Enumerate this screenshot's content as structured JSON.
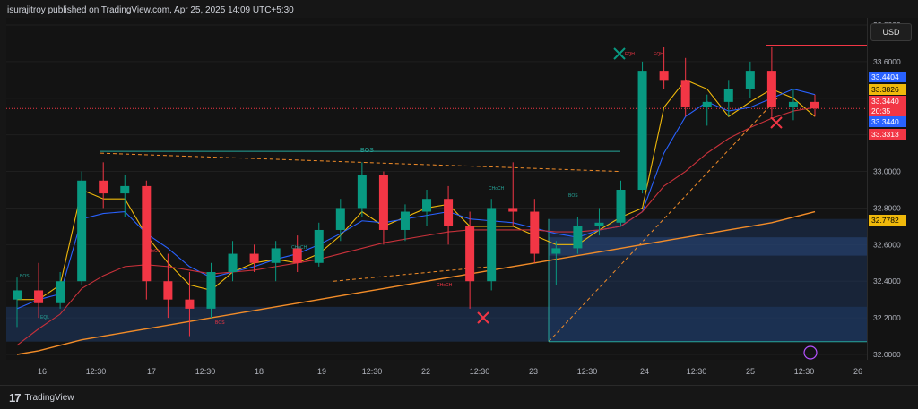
{
  "header": {
    "publisher": "isurajitroy published on TradingView.com, Apr 25, 2025 14:09 UTC+5:30"
  },
  "footer": {
    "brand": "TradingView",
    "logo": "17"
  },
  "currency_button": "USD",
  "colors": {
    "bull": "#089981",
    "bear": "#f23645",
    "ema_fast": "#f0b90b",
    "ema_mid": "#2962ff",
    "ema_slow": "#c7313a",
    "ema_long": "#f28c28",
    "zone": "#1f3a66",
    "bos": "#26a69a"
  },
  "chart_data": {
    "type": "candlestick",
    "symbol": "SILVER",
    "ylim": [
      32.0,
      33.8
    ],
    "y_ticks": [
      "33.8000",
      "33.6000",
      "33.4000",
      "33.2000",
      "33.0000",
      "32.8000",
      "32.6000",
      "32.4000",
      "32.2000",
      "32.0000"
    ],
    "x_ticks": [
      "16",
      "12:30",
      "17",
      "12:30",
      "18",
      "19",
      "12:30",
      "22",
      "12:30",
      "23",
      "12:30",
      "24",
      "12:30",
      "25",
      "12:30",
      "26"
    ],
    "price_labels": [
      {
        "value": "33.4404",
        "color": "#2962ff"
      },
      {
        "value": "33.3826",
        "color": "#f0b90b"
      },
      {
        "value": "SILVER",
        "color": "#f23645"
      },
      {
        "value": "33.3440",
        "color": "#f23645"
      },
      {
        "value": "20:35",
        "color": "#f23645"
      },
      {
        "value": "33.3440",
        "color": "#2962ff"
      },
      {
        "value": "33.3313",
        "color": "#f23645"
      },
      {
        "value": "32.7782",
        "color": "#f0b90b"
      }
    ],
    "annotations": [
      "BOS",
      "EQL",
      "BOS",
      "CHoCH",
      "CHoCH",
      "BOS",
      "CHoCH",
      "CHoCH",
      "BOS",
      "EQH",
      "EQH"
    ],
    "current_price": 33.344,
    "series": [
      {
        "name": "EMA fast",
        "values": [
          32.3,
          32.3,
          32.38,
          32.9,
          32.85,
          32.85,
          32.65,
          32.5,
          32.38,
          32.35,
          32.45,
          32.5,
          32.52,
          32.5,
          32.55,
          32.65,
          32.78,
          32.7,
          32.75,
          32.8,
          32.82,
          32.7,
          32.7,
          32.7,
          32.65,
          32.6,
          32.6,
          32.68,
          32.75,
          32.8,
          33.35,
          33.5,
          33.45,
          33.3,
          33.38,
          33.45,
          33.4,
          33.3
        ]
      },
      {
        "name": "EMA mid",
        "values": [
          32.25,
          32.3,
          32.33,
          32.74,
          32.77,
          32.78,
          32.66,
          32.58,
          32.48,
          32.42,
          32.45,
          32.48,
          32.52,
          32.55,
          32.6,
          32.66,
          32.73,
          32.72,
          32.74,
          32.76,
          32.78,
          32.74,
          32.73,
          32.72,
          32.69,
          32.66,
          32.64,
          32.68,
          32.7,
          32.78,
          33.1,
          33.3,
          33.38,
          33.33,
          33.35,
          33.4,
          33.45,
          33.42
        ]
      },
      {
        "name": "EMA slow",
        "values": [
          32.05,
          32.14,
          32.22,
          32.36,
          32.43,
          32.48,
          32.49,
          32.48,
          32.46,
          32.44,
          32.45,
          32.46,
          32.48,
          32.5,
          32.52,
          32.55,
          32.58,
          32.61,
          32.63,
          32.65,
          32.67,
          32.68,
          32.68,
          32.68,
          32.68,
          32.67,
          32.67,
          32.68,
          32.7,
          32.78,
          32.92,
          33.0,
          33.1,
          33.18,
          33.24,
          33.29,
          33.33,
          33.35
        ]
      },
      {
        "name": "EMA long",
        "values": [
          32.0,
          32.02,
          32.05,
          32.08,
          32.1,
          32.12,
          32.14,
          32.16,
          32.18,
          32.2,
          32.22,
          32.24,
          32.26,
          32.28,
          32.3,
          32.32,
          32.34,
          32.36,
          32.38,
          32.4,
          32.42,
          32.44,
          32.46,
          32.48,
          32.5,
          32.52,
          32.54,
          32.56,
          32.58,
          32.6,
          32.62,
          32.64,
          32.66,
          32.68,
          32.7,
          32.72,
          32.75,
          32.78
        ]
      }
    ],
    "candles": [
      {
        "o": 32.3,
        "h": 32.42,
        "l": 32.15,
        "c": 32.35
      },
      {
        "o": 32.35,
        "h": 32.5,
        "l": 32.2,
        "c": 32.28
      },
      {
        "o": 32.28,
        "h": 32.45,
        "l": 32.25,
        "c": 32.4
      },
      {
        "o": 32.4,
        "h": 33.0,
        "l": 32.38,
        "c": 32.95
      },
      {
        "o": 32.95,
        "h": 33.05,
        "l": 32.8,
        "c": 32.88
      },
      {
        "o": 32.88,
        "h": 32.98,
        "l": 32.75,
        "c": 32.92
      },
      {
        "o": 32.92,
        "h": 32.95,
        "l": 32.3,
        "c": 32.4
      },
      {
        "o": 32.4,
        "h": 32.55,
        "l": 32.2,
        "c": 32.3
      },
      {
        "o": 32.3,
        "h": 32.45,
        "l": 32.1,
        "c": 32.25
      },
      {
        "o": 32.25,
        "h": 32.5,
        "l": 32.2,
        "c": 32.45
      },
      {
        "o": 32.45,
        "h": 32.62,
        "l": 32.4,
        "c": 32.55
      },
      {
        "o": 32.55,
        "h": 32.6,
        "l": 32.45,
        "c": 32.5
      },
      {
        "o": 32.5,
        "h": 32.62,
        "l": 32.4,
        "c": 32.58
      },
      {
        "o": 32.58,
        "h": 32.65,
        "l": 32.45,
        "c": 32.5
      },
      {
        "o": 32.5,
        "h": 32.72,
        "l": 32.48,
        "c": 32.68
      },
      {
        "o": 32.68,
        "h": 32.85,
        "l": 32.62,
        "c": 32.8
      },
      {
        "o": 32.8,
        "h": 33.05,
        "l": 32.75,
        "c": 32.98
      },
      {
        "o": 32.98,
        "h": 33.0,
        "l": 32.6,
        "c": 32.68
      },
      {
        "o": 32.68,
        "h": 32.82,
        "l": 32.62,
        "c": 32.78
      },
      {
        "o": 32.78,
        "h": 32.9,
        "l": 32.7,
        "c": 32.85
      },
      {
        "o": 32.85,
        "h": 32.92,
        "l": 32.6,
        "c": 32.7
      },
      {
        "o": 32.7,
        "h": 32.78,
        "l": 32.25,
        "c": 32.4
      },
      {
        "o": 32.4,
        "h": 32.85,
        "l": 32.35,
        "c": 32.8
      },
      {
        "o": 32.8,
        "h": 33.05,
        "l": 32.7,
        "c": 32.78
      },
      {
        "o": 32.78,
        "h": 32.85,
        "l": 32.5,
        "c": 32.55
      },
      {
        "o": 32.55,
        "h": 32.62,
        "l": 32.38,
        "c": 32.58
      },
      {
        "o": 32.58,
        "h": 32.75,
        "l": 32.55,
        "c": 32.7
      },
      {
        "o": 32.7,
        "h": 32.8,
        "l": 32.65,
        "c": 32.72
      },
      {
        "o": 32.72,
        "h": 32.95,
        "l": 32.7,
        "c": 32.9
      },
      {
        "o": 32.9,
        "h": 33.6,
        "l": 32.88,
        "c": 33.55
      },
      {
        "o": 33.55,
        "h": 33.68,
        "l": 33.45,
        "c": 33.5
      },
      {
        "o": 33.5,
        "h": 33.62,
        "l": 33.3,
        "c": 33.35
      },
      {
        "o": 33.35,
        "h": 33.42,
        "l": 33.25,
        "c": 33.38
      },
      {
        "o": 33.38,
        "h": 33.5,
        "l": 33.3,
        "c": 33.45
      },
      {
        "o": 33.45,
        "h": 33.6,
        "l": 33.4,
        "c": 33.55
      },
      {
        "o": 33.55,
        "h": 33.68,
        "l": 33.3,
        "c": 33.35
      },
      {
        "o": 33.35,
        "h": 33.45,
        "l": 33.28,
        "c": 33.38
      },
      {
        "o": 33.38,
        "h": 33.42,
        "l": 33.3,
        "c": 33.344
      }
    ]
  }
}
